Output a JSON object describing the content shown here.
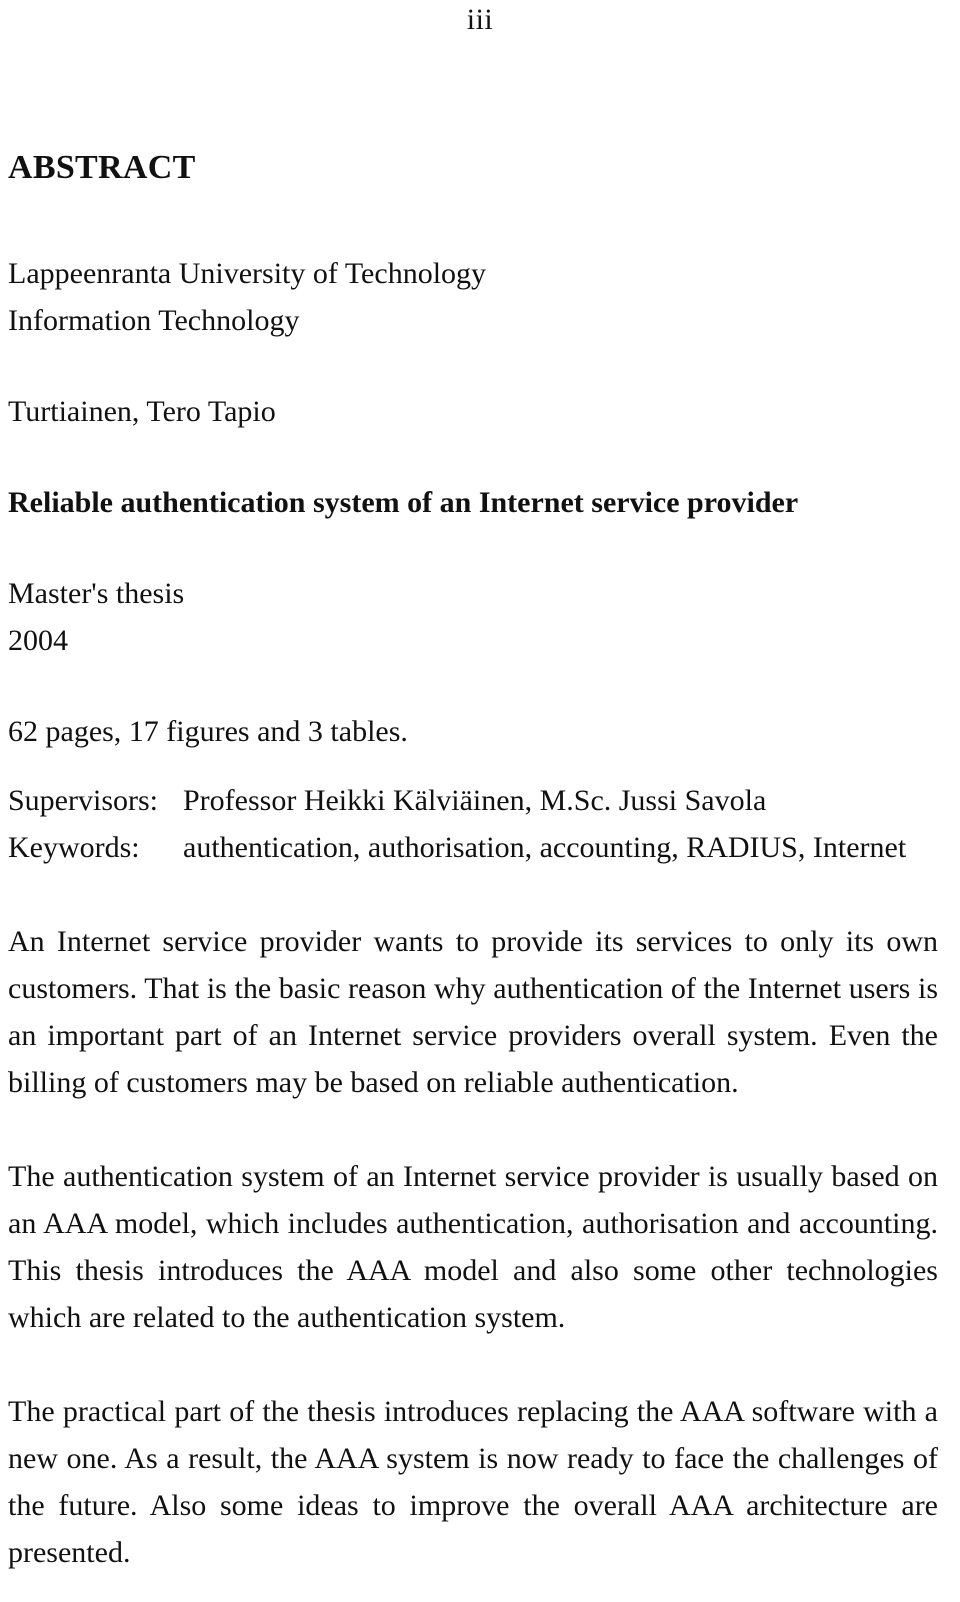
{
  "document": {
    "page_number": "iii",
    "heading": "ABSTRACT",
    "university": "Lappeenranta University of Technology",
    "department": "Information Technology",
    "author": "Turtiainen, Tero Tapio",
    "title": "Reliable authentication system of an Internet service provider",
    "thesis_type": "Master's thesis",
    "year": "2004",
    "extent": "62 pages, 17 figures and 3 tables.",
    "meta": [
      {
        "label": "Supervisors:",
        "value": "Professor Heikki Kälviäinen, M.Sc. Jussi Savola"
      },
      {
        "label": "Keywords:",
        "value": "authentication, authorisation, accounting, RADIUS, Internet"
      }
    ],
    "paragraphs": [
      "An Internet service provider wants to provide its services to only its own customers. That is the basic reason why authentication of the Internet users is an important part of an Internet service providers overall system. Even the billing of customers may be based on reliable authentication.",
      "The authentication system of an Internet service provider is usually based on an AAA model, which includes authentication, authorisation and accounting. This thesis introduces the AAA model and also some other technologies which are related to the authentication system.",
      "The practical part of the thesis introduces replacing the AAA software with a new one. As a result, the AAA system is now ready to face the challenges of the future. Also some ideas to improve the overall AAA architecture are presented."
    ]
  },
  "colors": {
    "page_background": "#ffffff",
    "text": "#111111"
  }
}
